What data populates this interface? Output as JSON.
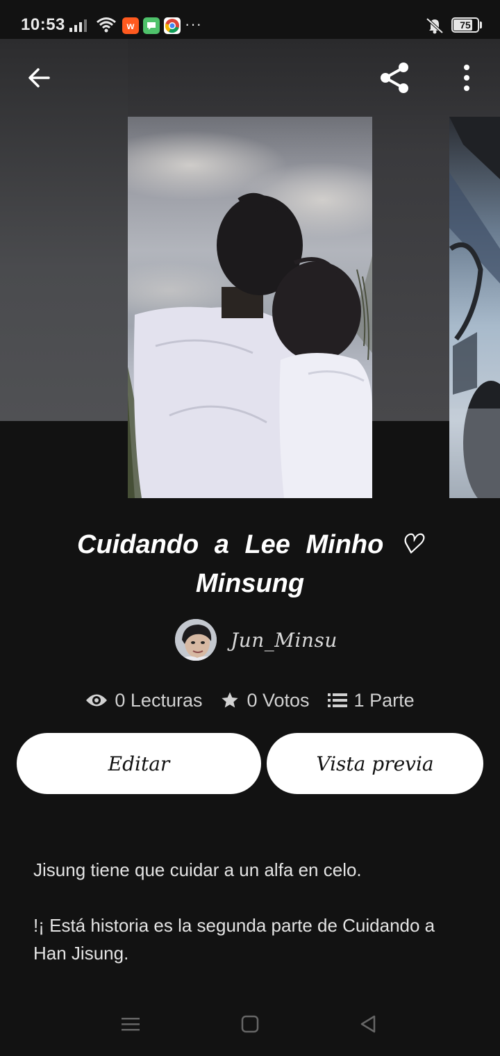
{
  "status_bar": {
    "time": "10:53",
    "battery": "75",
    "more": "···",
    "app_icons": [
      "wattpad-icon",
      "messages-icon",
      "chrome-icon"
    ]
  },
  "header": {
    "back_icon": "arrow-left-icon",
    "share_icon": "share-icon",
    "menu_icon": "more-vertical-icon"
  },
  "story": {
    "title": "Cuidando a Lee Minho ♡ Minsung",
    "author": "Jun_Minsu",
    "stats": {
      "reads": "0 Lecturas",
      "votes": "0 Votos",
      "parts": "1 Parte"
    },
    "edit_label": "Editar",
    "preview_label": "Vista previa",
    "description": [
      "Jisung tiene que cuidar a un alfa en celo.",
      "!¡ Está historia es la segunda parte de Cuidando a Han Jisung."
    ]
  },
  "nav": {
    "recents_icon": "recents-icon",
    "home_icon": "home-icon",
    "back_icon": "back-triangle-icon"
  },
  "colors": {
    "background": "#121212",
    "button_bg": "#ffffff",
    "text_primary": "#ffffff",
    "text_secondary": "#d2d2d2"
  }
}
